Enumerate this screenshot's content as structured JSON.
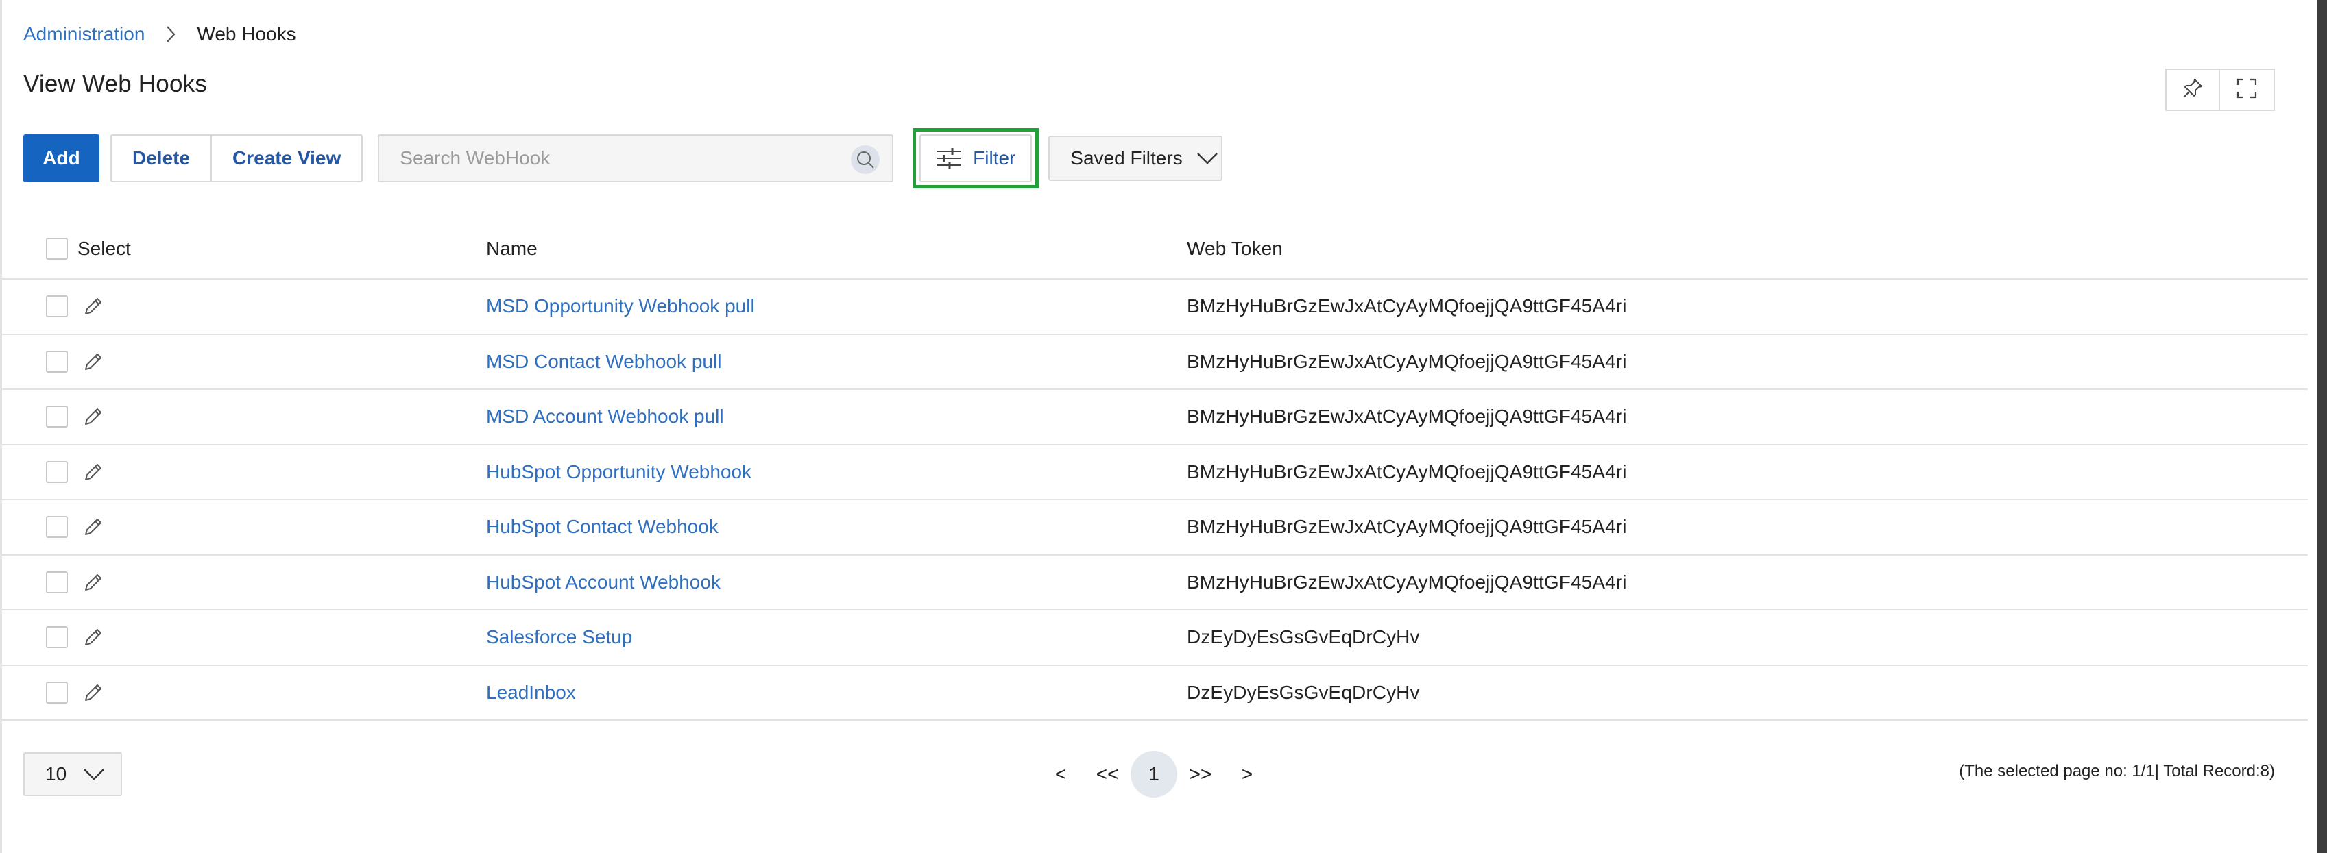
{
  "breadcrumb": {
    "parent": "Administration",
    "current": "Web Hooks"
  },
  "page": {
    "title": "View Web Hooks"
  },
  "top_icons": [
    "pin-icon",
    "fullscreen-icon"
  ],
  "toolbar": {
    "add_label": "Add",
    "delete_label": "Delete",
    "create_view_label": "Create View",
    "search_placeholder": "Search WebHook",
    "search_value": "",
    "filter_label": "Filter",
    "saved_filters_label": "Saved Filters"
  },
  "table": {
    "headers": {
      "select": "Select",
      "name": "Name",
      "token": "Web Token"
    },
    "rows": [
      {
        "name": "MSD Opportunity Webhook pull",
        "token": "BMzHyHuBrGzEwJxAtCyAyMQfoejjQA9ttGF45A4ri"
      },
      {
        "name": "MSD Contact Webhook pull",
        "token": "BMzHyHuBrGzEwJxAtCyAyMQfoejjQA9ttGF45A4ri"
      },
      {
        "name": "MSD Account Webhook pull",
        "token": "BMzHyHuBrGzEwJxAtCyAyMQfoejjQA9ttGF45A4ri"
      },
      {
        "name": "HubSpot Opportunity Webhook",
        "token": "BMzHyHuBrGzEwJxAtCyAyMQfoejjQA9ttGF45A4ri"
      },
      {
        "name": "HubSpot Contact Webhook",
        "token": "BMzHyHuBrGzEwJxAtCyAyMQfoejjQA9ttGF45A4ri"
      },
      {
        "name": "HubSpot Account Webhook",
        "token": "BMzHyHuBrGzEwJxAtCyAyMQfoejjQA9ttGF45A4ri"
      },
      {
        "name": "Salesforce Setup",
        "token": "DzEyDyEsGsGvEqDrCyHv"
      },
      {
        "name": "LeadInbox",
        "token": "DzEyDyEsGsGvEqDrCyHv"
      }
    ]
  },
  "footer": {
    "page_size": "10",
    "pagination": {
      "prev": "<",
      "first": "<<",
      "current": "1",
      "last": ">>",
      "next": ">"
    },
    "record_info": "(The selected page no: 1/1| Total Record:8)"
  },
  "colors": {
    "primary": "#1565c0",
    "link": "#2f6fbf",
    "highlight": "#22a03a"
  }
}
